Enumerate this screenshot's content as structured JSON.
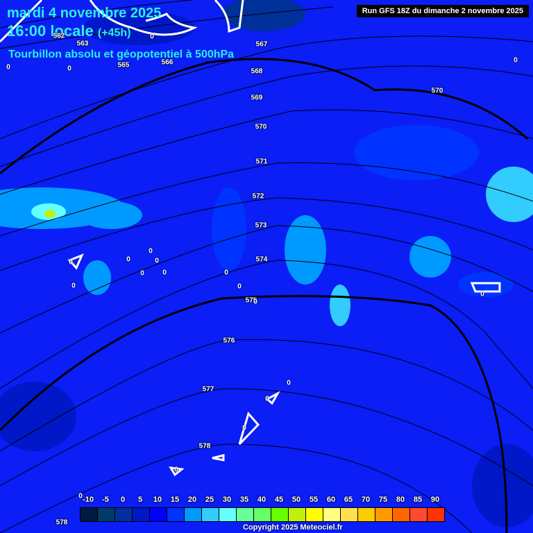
{
  "header": {
    "date": "mardi 4 novembre 2025",
    "time": "16:00 locale",
    "lead": "(+45h)",
    "subtitle": "Tourbillon absolu et géopotentiel à 500hPa",
    "run": "Run GFS 18Z du dimanche 2 novembre 2025"
  },
  "contour_labels": [
    "562",
    "563",
    "565",
    "566",
    "567",
    "568",
    "569",
    "570",
    "570",
    "571",
    "572",
    "573",
    "574",
    "575",
    "576",
    "577",
    "578",
    "578"
  ],
  "zero_label": "0",
  "legend": {
    "ticks": [
      "-10",
      "-5",
      "0",
      "5",
      "10",
      "15",
      "20",
      "25",
      "30",
      "35",
      "40",
      "45",
      "50",
      "55",
      "60",
      "65",
      "70",
      "75",
      "80",
      "85",
      "90"
    ],
    "colors": [
      "#001a40",
      "#003a66",
      "#00309a",
      "#0018c8",
      "#0000ff",
      "#0033ff",
      "#0099ff",
      "#33ccff",
      "#66ffff",
      "#66ff99",
      "#66ff66",
      "#66ff00",
      "#c0f010",
      "#ffff00",
      "#ffff80",
      "#ffe050",
      "#ffcc00",
      "#ff9900",
      "#ff6600",
      "#ff4a33",
      "#ff3300"
    ]
  },
  "copyright": "Copyright 2025 Meteociel.fr"
}
